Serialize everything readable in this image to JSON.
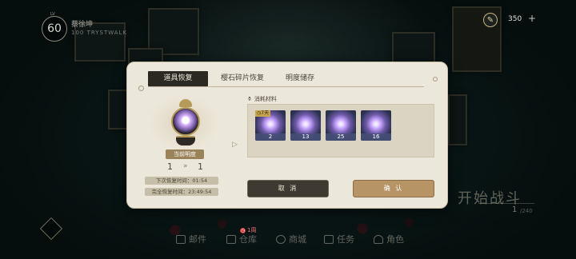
{
  "player": {
    "level_tag": "LV",
    "level": "60",
    "name": "蔡徐坤",
    "subtitle": "100 TRYSTWALK"
  },
  "currency": {
    "icon": "quill-icon",
    "value": "350",
    "add_label": "+"
  },
  "home": {
    "start_battle_label": "开始战斗",
    "stage_current": "1",
    "stage_total": "/240"
  },
  "bottom_nav": {
    "items": [
      {
        "label": "邮件",
        "icon": "mail-icon"
      },
      {
        "label": "仓库",
        "icon": "warehouse-icon"
      },
      {
        "label": "商城",
        "icon": "shop-icon"
      },
      {
        "label": "任务",
        "icon": "task-icon"
      },
      {
        "label": "角色",
        "icon": "character-icon"
      }
    ],
    "warehouse_badge": "1周"
  },
  "modal": {
    "tabs": [
      {
        "label": "道具恢复",
        "active": true
      },
      {
        "label": "樱石碎片恢复",
        "active": false
      },
      {
        "label": "明度储存",
        "active": false
      }
    ],
    "current_label": "当前明度",
    "current_value": "1",
    "arrow": "»",
    "next_value": "1",
    "next_recover_label": "下次恢复时间：01:54",
    "full_recover_label": "完全恢复时间：23:49:54",
    "materials_title": "消耗材料",
    "items": [
      {
        "count": "2",
        "tag": "7天"
      },
      {
        "count": "13",
        "tag": ""
      },
      {
        "count": "25",
        "tag": ""
      },
      {
        "count": "16",
        "tag": ""
      }
    ],
    "cancel_label": "取 消",
    "confirm_label": "确 认"
  },
  "colors": {
    "accent": "#b69466",
    "dark": "#2c2923",
    "panel": "#ece7db"
  }
}
